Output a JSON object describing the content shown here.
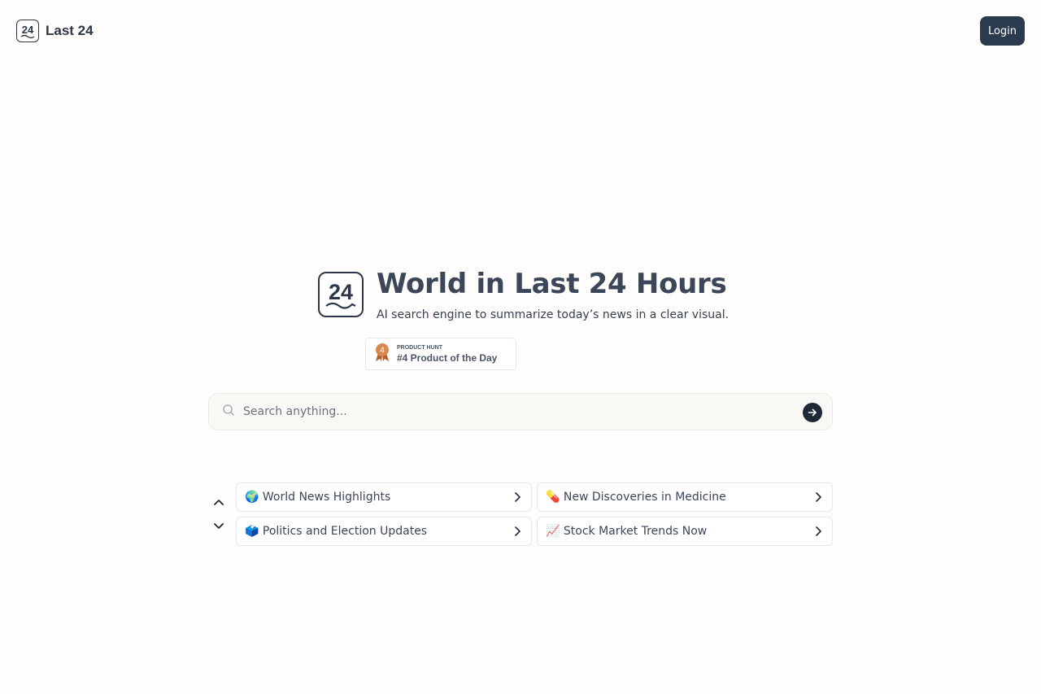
{
  "header": {
    "brand_name": "Last 24",
    "login_label": "Login"
  },
  "hero": {
    "title": "World in Last 24 Hours",
    "subtitle": "AI search engine to summarize today’s news in a clear visual."
  },
  "badge": {
    "source": "PRODUCT HUNT",
    "label": "#4 Product of the Day",
    "rank": "4"
  },
  "search": {
    "placeholder": "Search anything...",
    "value": ""
  },
  "suggestions": [
    {
      "emoji": "🌍",
      "label": "World News Highlights"
    },
    {
      "emoji": "💊",
      "label": "New Discoveries in Medicine"
    },
    {
      "emoji": "🗳️",
      "label": "Politics and Election Updates"
    },
    {
      "emoji": "📈",
      "label": "Stock Market Trends Now"
    }
  ],
  "colors": {
    "background": "#fefdfb",
    "accent": "#2c3a4f",
    "text": "#3c4659",
    "badge_medal": "#c8743a"
  },
  "icons": [
    "logo-24-icon",
    "medal-icon",
    "search-icon",
    "arrow-right-icon",
    "chevron-up-icon",
    "chevron-down-icon",
    "chevron-right-icon"
  ]
}
